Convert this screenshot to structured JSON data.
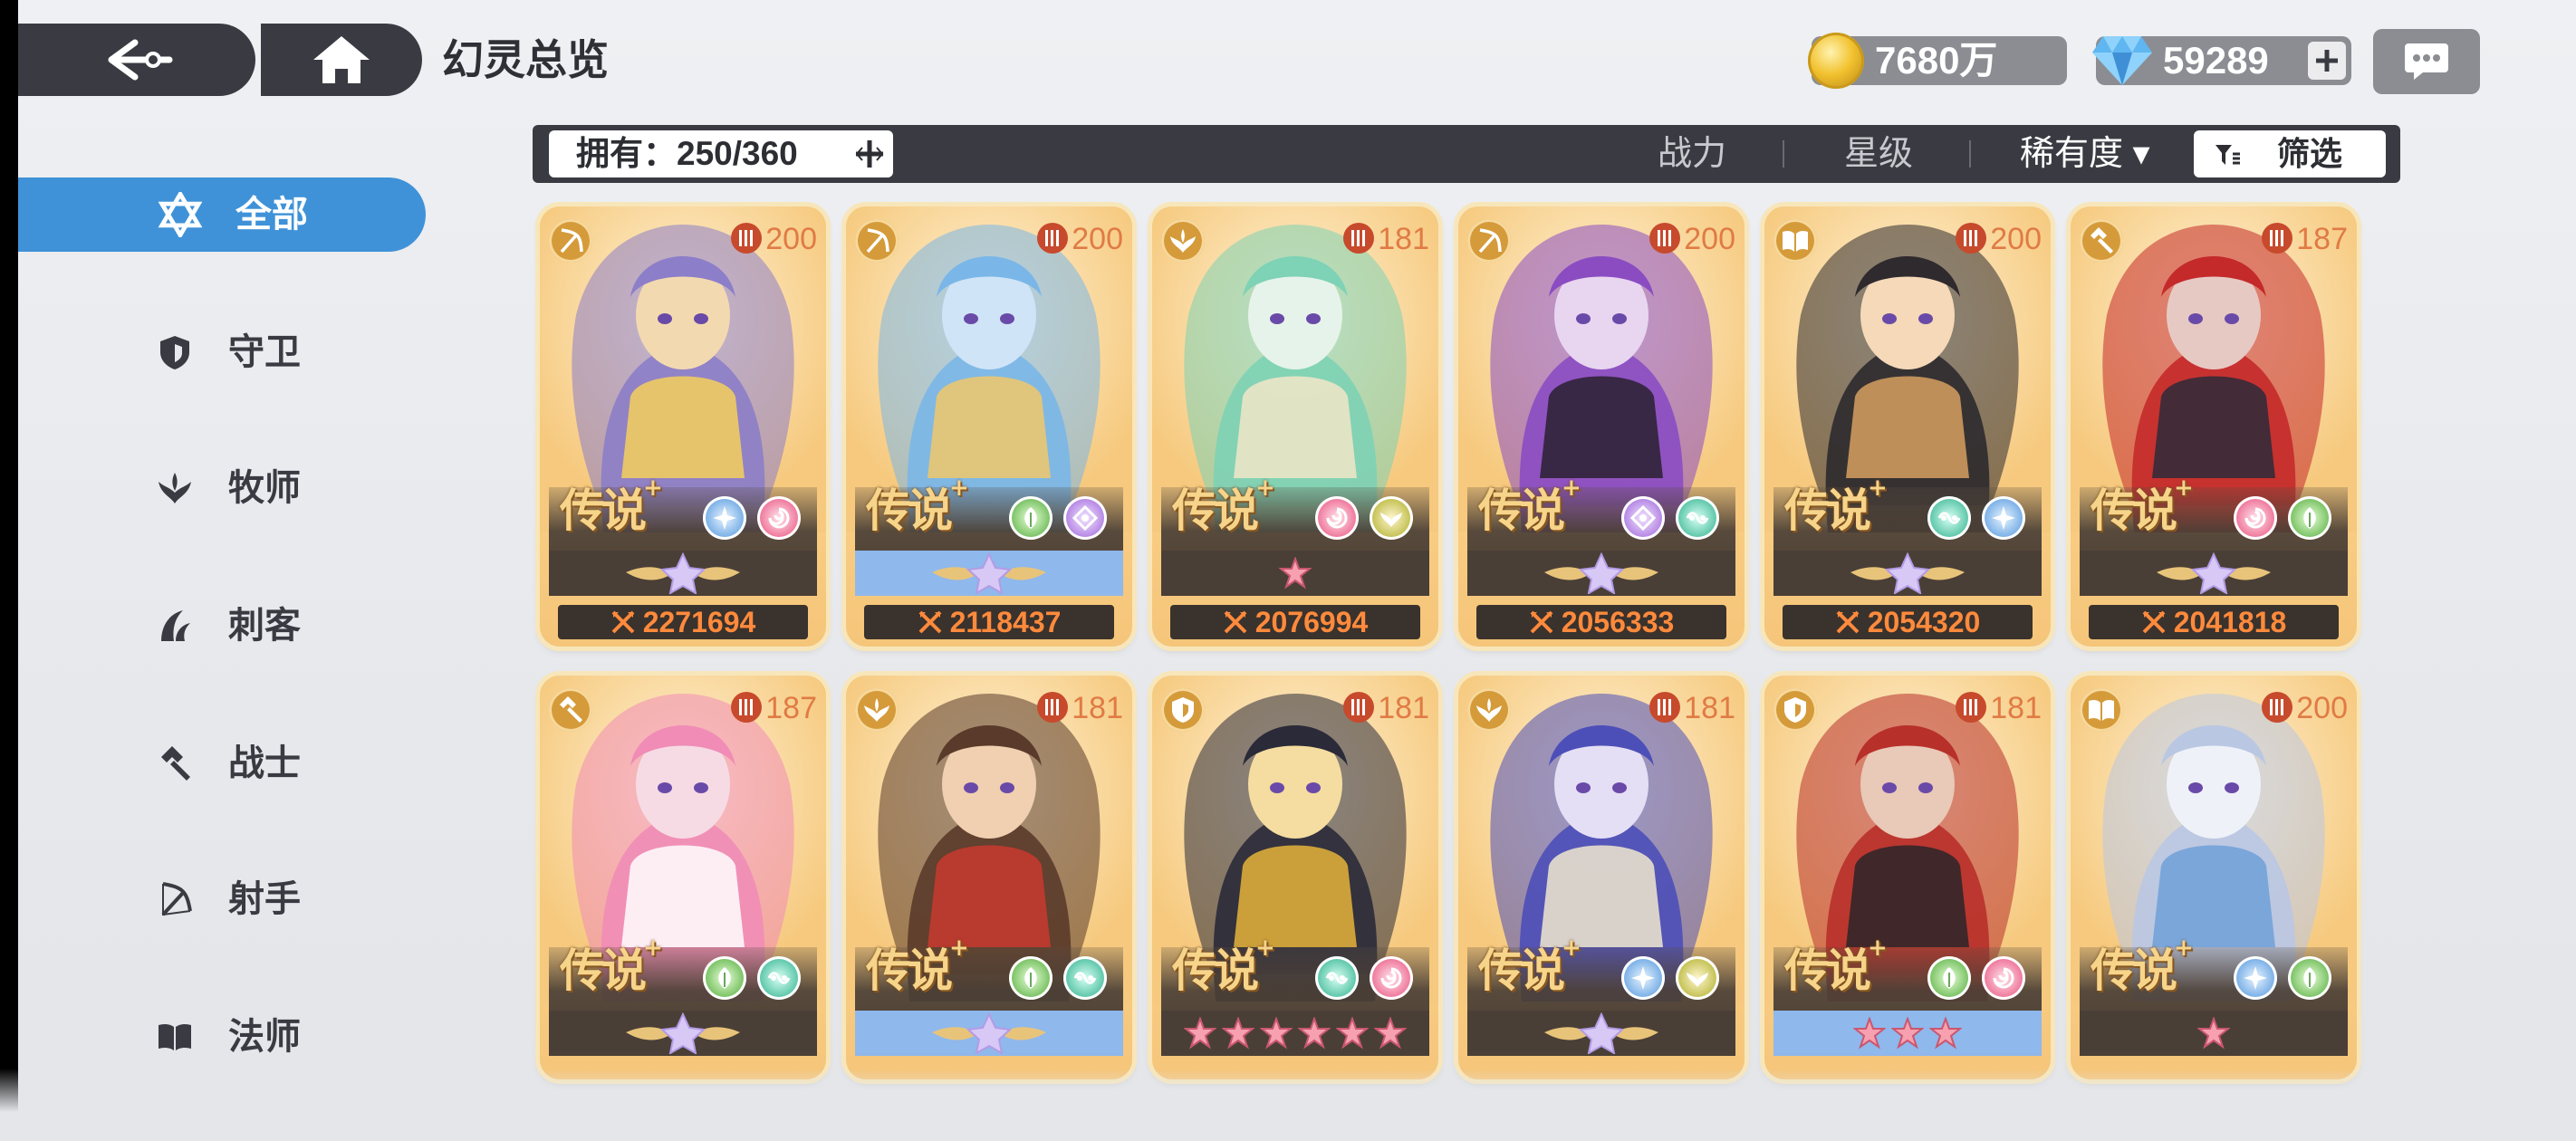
{
  "header": {
    "title": "幻灵总览",
    "gold": "7680万",
    "gems": "59289"
  },
  "sidebar": {
    "items": [
      {
        "label": "全部",
        "icon": "star-of-david-icon",
        "active": true
      },
      {
        "label": "守卫",
        "icon": "shield-icon"
      },
      {
        "label": "牧师",
        "icon": "wing-icon"
      },
      {
        "label": "刺客",
        "icon": "claw-icon"
      },
      {
        "label": "战士",
        "icon": "hammer-icon"
      },
      {
        "label": "射手",
        "icon": "bow-icon"
      },
      {
        "label": "法师",
        "icon": "book-icon"
      }
    ]
  },
  "filter": {
    "owned": "拥有：250/360",
    "sort_power": "战力",
    "sort_star": "星级",
    "sort_rarity": "稀有度 ▾",
    "screen": "筛选"
  },
  "cards": [
    {
      "role": "bow",
      "level": "200",
      "rank": "传说",
      "elements": [
        "star",
        "pink"
      ],
      "stars_type": "crest",
      "stars_bg": "dark",
      "power": "2271694",
      "palette": [
        "#f3d9b0",
        "#8c7ec8",
        "#f4d05a"
      ]
    },
    {
      "role": "bow",
      "level": "200",
      "rank": "传说",
      "elements": [
        "leaf",
        "violet"
      ],
      "stars_type": "crest",
      "stars_bg": "blue",
      "power": "2118437",
      "palette": [
        "#cfe4f7",
        "#7ab7e8",
        "#f0c86a"
      ]
    },
    {
      "role": "wing",
      "level": "181",
      "rank": "传说",
      "elements": [
        "pink",
        "wing"
      ],
      "stars_type": "pink1",
      "stars_bg": "dark",
      "power": "2076994",
      "palette": [
        "#e6f3ea",
        "#7ed2b5",
        "#f2e6c8"
      ]
    },
    {
      "role": "bow",
      "level": "200",
      "rank": "传说",
      "elements": [
        "violet",
        "aqua"
      ],
      "stars_type": "crest",
      "stars_bg": "dark",
      "power": "2056333",
      "palette": [
        "#e8d6f0",
        "#8b4cc2",
        "#2a2030"
      ]
    },
    {
      "role": "book",
      "level": "200",
      "rank": "传说",
      "elements": [
        "aqua",
        "star"
      ],
      "stars_type": "crest",
      "stars_bg": "dark",
      "power": "2054320",
      "palette": [
        "#f5d9b8",
        "#2e2a2e",
        "#d6a060"
      ]
    },
    {
      "role": "hammer",
      "level": "187",
      "rank": "传说",
      "elements": [
        "pink",
        "leaf"
      ],
      "stars_type": "crest",
      "stars_bg": "dark",
      "power": "2041818",
      "palette": [
        "#e7c9c4",
        "#c42a2a",
        "#2c2a3a"
      ]
    },
    {
      "role": "hammer",
      "level": "187",
      "rank": "传说",
      "elements": [
        "leaf",
        "aqua"
      ],
      "stars_type": "crest",
      "stars_bg": "dark",
      "power": "",
      "palette": [
        "#f6dbe4",
        "#f08cb6",
        "#ffffff"
      ]
    },
    {
      "role": "wing",
      "level": "181",
      "rank": "传说",
      "elements": [
        "leaf",
        "aqua"
      ],
      "stars_type": "crest",
      "stars_bg": "blue",
      "power": "",
      "palette": [
        "#f0d0b0",
        "#5a3a2a",
        "#c9392e"
      ]
    },
    {
      "role": "shield",
      "level": "181",
      "rank": "传说",
      "elements": [
        "aqua",
        "pink"
      ],
      "stars_type": "pink6",
      "stars_bg": "dark",
      "power": "",
      "palette": [
        "#f5dca0",
        "#2a2a38",
        "#e6b43a"
      ]
    },
    {
      "role": "wing",
      "level": "181",
      "rank": "传说",
      "elements": [
        "star",
        "wing"
      ],
      "stars_type": "crest",
      "stars_bg": "dark",
      "power": "",
      "palette": [
        "#e4dff5",
        "#4d4fb8",
        "#f1e9cf"
      ]
    },
    {
      "role": "shield",
      "level": "181",
      "rank": "传说",
      "elements": [
        "leaf",
        "pink"
      ],
      "stars_type": "pink3",
      "stars_bg": "blue",
      "power": "",
      "palette": [
        "#e9c9b8",
        "#b8302a",
        "#2a2428"
      ]
    },
    {
      "role": "book",
      "level": "200",
      "rank": "传说",
      "elements": [
        "star",
        "leaf"
      ],
      "stars_type": "pink1",
      "stars_bg": "dark",
      "power": "",
      "palette": [
        "#eef2f8",
        "#b9c7e3",
        "#6fa0d8"
      ]
    }
  ]
}
